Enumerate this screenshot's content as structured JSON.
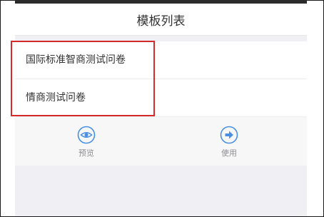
{
  "header": {
    "title": "模板列表"
  },
  "templates": [
    {
      "name": "国际标准智商测试问卷"
    },
    {
      "name": "情商测试问卷"
    }
  ],
  "actions": {
    "preview": {
      "label": "预览",
      "icon": "eye-icon"
    },
    "use": {
      "label": "使用",
      "icon": "arrow-right-circle-icon"
    }
  },
  "colors": {
    "accent": "#4a90e2",
    "annotation": "#d42a2a"
  }
}
